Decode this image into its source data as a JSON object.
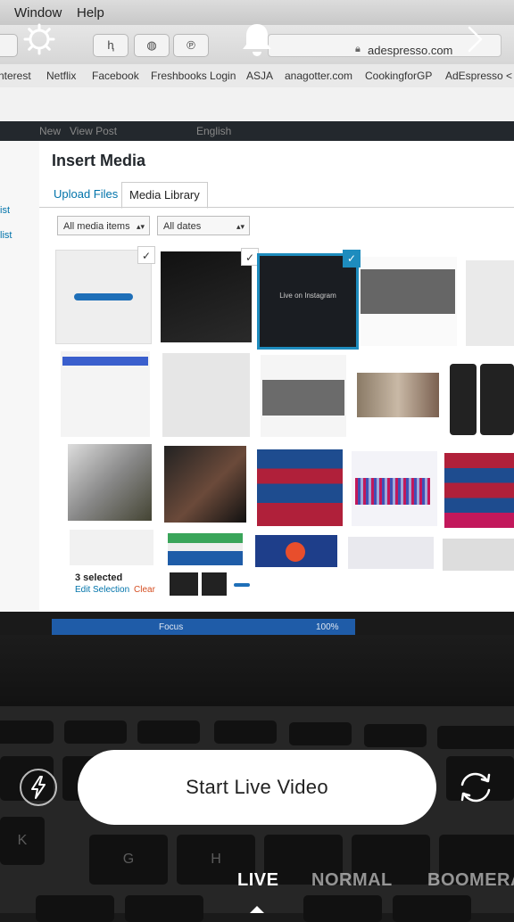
{
  "browser": {
    "menu": [
      "Window",
      "Help"
    ],
    "url": "adespresso.com",
    "bookmarks": [
      "nterest",
      "Netflix",
      "Facebook",
      "Freshbooks Login",
      "ASJA",
      "anagotter.com",
      "CookingforGP",
      "AdEspresso < L"
    ]
  },
  "wp": {
    "admin_bar": [
      "New",
      "View Post",
      "English"
    ],
    "sidebar_links": [
      "ist",
      "list"
    ]
  },
  "media_modal": {
    "title": "Insert Media",
    "tabs": [
      "Upload Files",
      "Media Library"
    ],
    "active_tab": "Media Library",
    "filters": [
      "All media items",
      "All dates"
    ],
    "tile_caption": "Live on Instagram",
    "selected_count": "3 selected",
    "edit_selection": "Edit Selection",
    "clear": "Clear"
  },
  "taskbar": {
    "focus": "Focus",
    "zoom": "100%"
  },
  "keyboard": {
    "keys": [
      "K",
      "G",
      "H"
    ]
  },
  "live": {
    "start_button": "Start Live Video",
    "modes": [
      "LIVE",
      "NORMAL",
      "BOOMERA"
    ],
    "active_mode": "LIVE"
  },
  "icons": [
    "settings-icon",
    "bell-icon",
    "chevron-right-icon",
    "flash-icon",
    "camera-flip-icon"
  ]
}
